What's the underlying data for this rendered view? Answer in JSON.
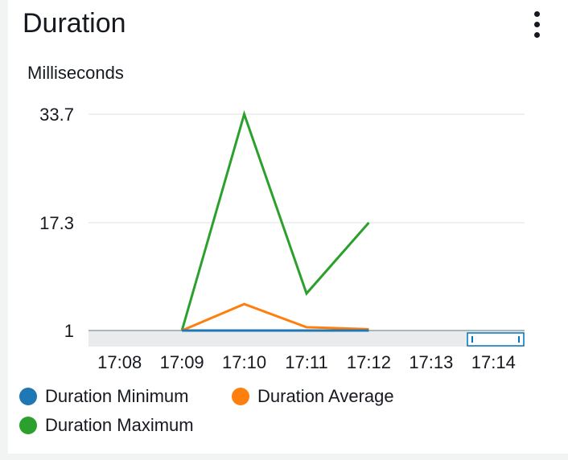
{
  "widget": {
    "title": "Duration",
    "menu_icon": "kebab-menu-icon"
  },
  "chart_data": {
    "type": "line",
    "ylabel": "Milliseconds",
    "ylim": [
      1,
      33.7
    ],
    "yticks": [
      "33.7",
      "17.3",
      "1"
    ],
    "ytick_values": [
      33.7,
      17.3,
      1
    ],
    "x_range": [
      "17:07:30",
      "17:14:30"
    ],
    "xtick_labels": [
      "17:08",
      "17:09",
      "17:10",
      "17:11",
      "17:12",
      "17:13",
      "17:14"
    ],
    "grid": true,
    "legend_position": "bottom",
    "series": [
      {
        "name": "Duration Minimum",
        "color": "#1f77b4",
        "x": [
          "17:09",
          "17:10",
          "17:11",
          "17:12"
        ],
        "values": [
          1,
          1,
          1,
          1
        ]
      },
      {
        "name": "Duration Average",
        "color": "#ff7f0e",
        "x": [
          "17:09",
          "17:10",
          "17:11",
          "17:12"
        ],
        "values": [
          1,
          5,
          1.5,
          1.2
        ]
      },
      {
        "name": "Duration Maximum",
        "color": "#2ca02c",
        "x": [
          "17:09",
          "17:10",
          "17:11",
          "17:12"
        ],
        "values": [
          1,
          33.7,
          6.6,
          17.3
        ]
      }
    ]
  }
}
